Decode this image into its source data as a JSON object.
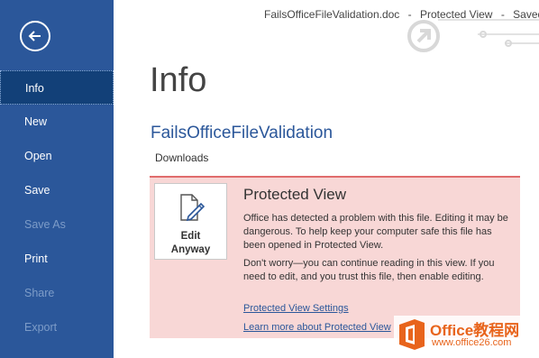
{
  "titlebar": {
    "filename": "FailsOfficeFileValidation.doc",
    "separator1": "-",
    "mode": "Protected View",
    "separator2": "-",
    "save_status": "Saved to"
  },
  "nav": {
    "items": [
      {
        "label": "Info",
        "state": "active"
      },
      {
        "label": "New",
        "state": "enabled"
      },
      {
        "label": "Open",
        "state": "enabled"
      },
      {
        "label": "Save",
        "state": "enabled"
      },
      {
        "label": "Save As",
        "state": "disabled"
      },
      {
        "label": "Print",
        "state": "enabled"
      },
      {
        "label": "Share",
        "state": "disabled"
      },
      {
        "label": "Export",
        "state": "disabled"
      }
    ]
  },
  "main": {
    "title": "Info",
    "doc_name": "FailsOfficeFileValidation",
    "doc_path": "Downloads"
  },
  "protected_view": {
    "button_label": "Edit\nAnyway",
    "title": "Protected View",
    "message": "Office has detected a problem with this file. Editing it may be dangerous. To help keep your computer safe this file has been opened in Protected View.",
    "advice": "Don't worry—you can continue reading in this view. If you need to edit, and you trust this file, then enable editing.",
    "link_settings": "Protected View Settings",
    "link_learn": "Learn more about Protected View"
  },
  "watermark": {
    "brand": "Office教程网",
    "url": "www.office26.com"
  },
  "colors": {
    "nav_bg": "#2b579a",
    "nav_active": "#124078",
    "accent": "#2b579a",
    "pv_bg": "#f8d7d6",
    "pv_border": "#e06c6c",
    "watermark": "#e8641c"
  }
}
